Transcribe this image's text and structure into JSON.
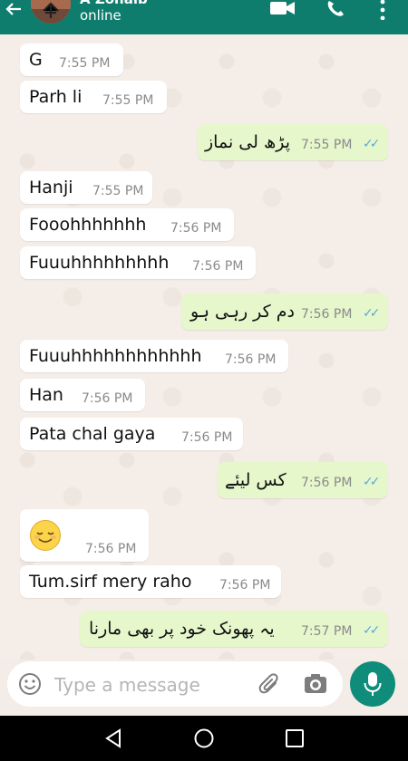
{
  "header": {
    "contact_name": "A Zohaib",
    "status": "online",
    "back_icon": "arrow-left-icon",
    "video_icon": "video-call-icon",
    "call_icon": "phone-icon",
    "menu_icon": "more-vert-icon"
  },
  "messages": [
    {
      "dir": "in",
      "text": "G",
      "time": "7:55 PM"
    },
    {
      "dir": "in",
      "text": "Parh li",
      "time": "7:55 PM"
    },
    {
      "dir": "out",
      "text": "پڑھ لی نماز",
      "time": "7:55 PM",
      "status": "read"
    },
    {
      "dir": "in",
      "text": "Hanji",
      "time": "7:55 PM"
    },
    {
      "dir": "in",
      "text": "Fooohhhhhhh",
      "time": "7:56 PM"
    },
    {
      "dir": "in",
      "text": "Fuuuhhhhhhhhh",
      "time": "7:56 PM"
    },
    {
      "dir": "out",
      "text": "دم کر رہی ہو",
      "time": "7:56 PM",
      "status": "read"
    },
    {
      "dir": "in",
      "text": "Fuuuhhhhhhhhhhhh",
      "time": "7:56 PM"
    },
    {
      "dir": "in",
      "text": "Han",
      "time": "7:56 PM"
    },
    {
      "dir": "in",
      "text": "Pata chal gaya",
      "time": "7:56 PM"
    },
    {
      "dir": "out",
      "text": "کس لیئے",
      "time": "7:56 PM",
      "status": "read"
    },
    {
      "dir": "in",
      "emoji": "relieved-face",
      "time": "7:56 PM"
    },
    {
      "dir": "in",
      "text": "Tum.sirf mery raho",
      "time": "7:56 PM"
    },
    {
      "dir": "out",
      "text": "یہ پھونک خود پر بھی مارنا",
      "time": "7:57 PM",
      "status": "read"
    }
  ],
  "composer": {
    "placeholder": "Type a message",
    "emoji_icon": "emoji-icon",
    "attach_icon": "paperclip-icon",
    "camera_icon": "camera-icon",
    "mic_icon": "microphone-icon"
  },
  "nav": {
    "back_icon": "nav-back-icon",
    "home_icon": "nav-home-icon",
    "recent_icon": "nav-recent-icon"
  },
  "colors": {
    "header": "#0f7d6e",
    "incoming_bubble": "#ffffff",
    "outgoing_bubble": "#e6f7cc",
    "read_ticks": "#5da8d8",
    "mic_button": "#0f8c7a",
    "chat_background": "#f5ede8"
  }
}
